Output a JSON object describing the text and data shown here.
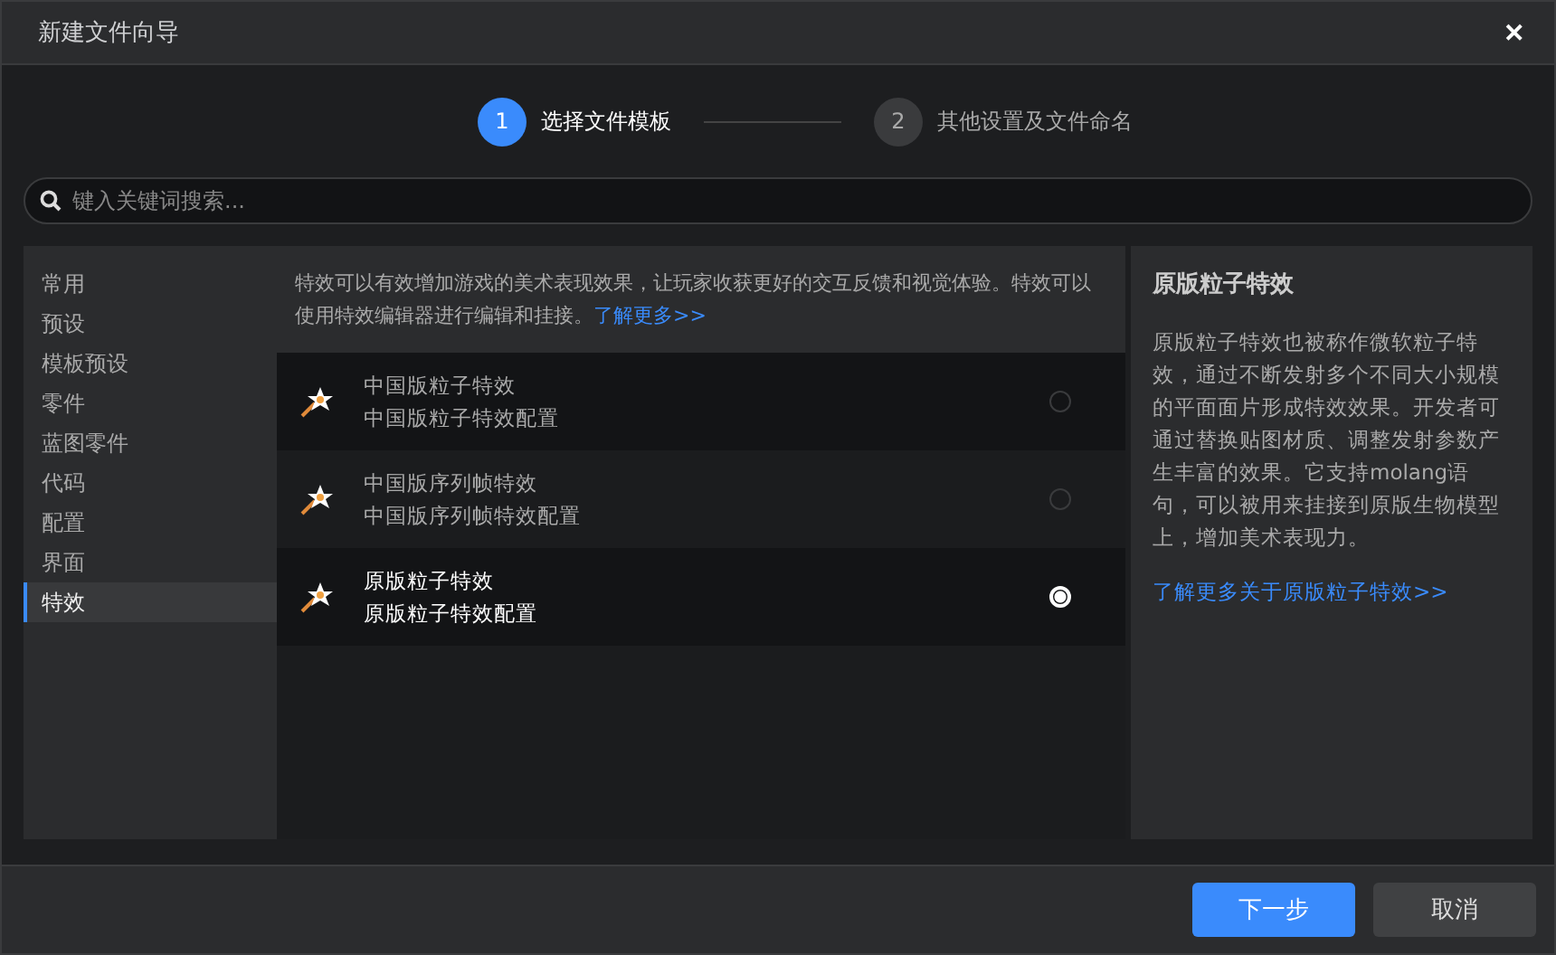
{
  "window": {
    "title": "新建文件向导",
    "close": "✕"
  },
  "steps": [
    {
      "number": "1",
      "label": "选择文件模板",
      "selected": true
    },
    {
      "number": "2",
      "label": "其他设置及文件命名",
      "selected": false
    }
  ],
  "search": {
    "placeholder": "键入关键词搜索..."
  },
  "sidebar": {
    "items": [
      {
        "label": "常用",
        "selected": false
      },
      {
        "label": "预设",
        "selected": false
      },
      {
        "label": "模板预设",
        "selected": false
      },
      {
        "label": "零件",
        "selected": false
      },
      {
        "label": "蓝图零件",
        "selected": false
      },
      {
        "label": "代码",
        "selected": false
      },
      {
        "label": "配置",
        "selected": false
      },
      {
        "label": "界面",
        "selected": false
      },
      {
        "label": "特效",
        "selected": true
      }
    ]
  },
  "intro": {
    "text": "特效可以有效增加游戏的美术表现效果，让玩家收获更好的交互反馈和视觉体验。特效可以使用特效编辑器进行编辑和挂接。",
    "link": "了解更多>>"
  },
  "templates": [
    {
      "title": "中国版粒子特效",
      "subtitle": "中国版粒子特效配置",
      "selected": false
    },
    {
      "title": "中国版序列帧特效",
      "subtitle": "中国版序列帧特效配置",
      "selected": false
    },
    {
      "title": "原版粒子特效",
      "subtitle": "原版粒子特效配置",
      "selected": true
    }
  ],
  "detail": {
    "title": "原版粒子特效",
    "description": "原版粒子特效也被称作微软粒子特效，通过不断发射多个不同大小规模的平面面片形成特效效果。开发者可通过替换贴图材质、调整发射参数产生丰富的效果。它支持molang语句，可以被用来挂接到原版生物模型上，增加美术表现力。",
    "link": "了解更多关于原版粒子特效>>"
  },
  "buttons": [
    {
      "label": "下一步",
      "kind": "primary"
    },
    {
      "label": "取消",
      "kind": "secondary"
    }
  ]
}
